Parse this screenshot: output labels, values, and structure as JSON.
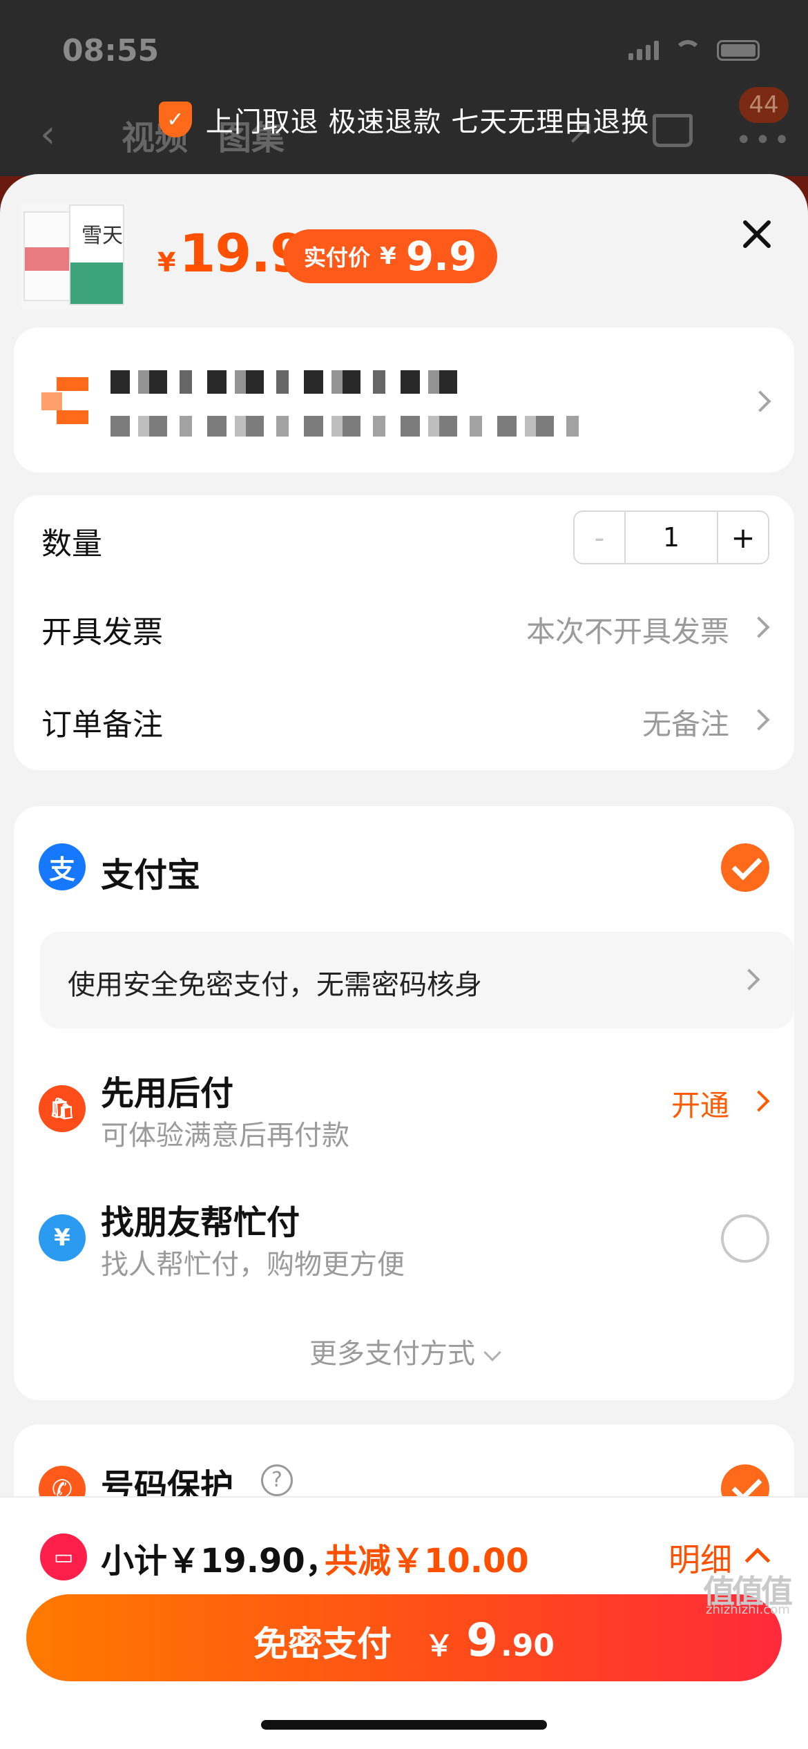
{
  "status_bar": {
    "time": "08:55"
  },
  "background_nav": {
    "tab_video": "视频",
    "tab_gallery": "图集",
    "cart_badge": "44"
  },
  "banner": {
    "text": "上门取退 极速退款 七天无理由退换"
  },
  "product": {
    "currency": "¥",
    "price": "19.9",
    "actual_label": "实付价",
    "actual_currency": "¥",
    "actual_price": "9.9"
  },
  "options": {
    "quantity_label": "数量",
    "quantity_minus": "-",
    "quantity_value": "1",
    "quantity_plus": "+",
    "invoice_label": "开具发票",
    "invoice_value": "本次不开具发票",
    "remark_label": "订单备注",
    "remark_value": "无备注"
  },
  "payment": {
    "alipay_icon": "支",
    "alipay_title": "支付宝",
    "secure_text": "使用安全免密支付，无需密码核身",
    "later_title": "先用后付",
    "later_sub": "可体验满意后再付款",
    "later_action": "开通",
    "friend_icon": "¥",
    "friend_title": "找朋友帮忙付",
    "friend_sub": "找人帮忙付，购物更方便",
    "more_methods": "更多支付方式"
  },
  "privacy": {
    "title": "号码保护",
    "help_icon": "?"
  },
  "summary": {
    "subtotal_text": "小计￥19.90，",
    "discount_text": "共减￥10.00",
    "detail_label": "明细"
  },
  "pay_button": {
    "label": "免密支付",
    "currency": "￥",
    "integer": "9",
    "decimal": ".90"
  },
  "watermark": {
    "text": "值值值",
    "sub": "zhizhizhi.com"
  },
  "colors": {
    "accent": "#ff5000",
    "alipay_blue": "#1677ff",
    "button_gradient_start": "#ff7a00",
    "button_gradient_end": "#ff2a3a"
  },
  "icons": [
    "shield-check-icon",
    "back-arrow-icon",
    "share-icon",
    "cart-icon",
    "more-icon",
    "close-icon",
    "taobao-logo-icon",
    "chevron-right-icon",
    "alipay-icon",
    "check-icon",
    "pay-later-bag-icon",
    "friend-pay-icon",
    "phone-protect-icon",
    "help-icon",
    "coupon-icon",
    "chevron-up-icon"
  ]
}
